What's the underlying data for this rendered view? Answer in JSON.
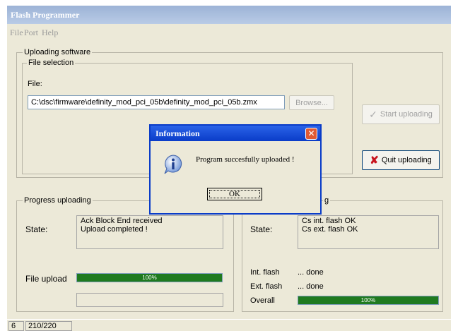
{
  "window": {
    "title": "Flash Programmer"
  },
  "menu": {
    "items": [
      "File",
      "Port",
      "Help"
    ]
  },
  "uploading": {
    "group_label": "Uploading software",
    "file_selection_label": "File selection",
    "file_label": "File:",
    "file_path": "C:\\dsc\\firmware\\definity_mod_pci_05b\\definity_mod_pci_05b.zmx",
    "browse_label": "Browse...",
    "start_label": "Start uploading",
    "quit_label": "Quit uploading"
  },
  "progress": {
    "group_label": "Progress uploading",
    "state_label": "State:",
    "state_lines": [
      "Ack Block End received",
      "Upload completed !"
    ],
    "file_upload_label": "File upload",
    "file_upload_percent": 100,
    "file_upload_text": "100%"
  },
  "flashing": {
    "group_label_visible": "g",
    "state_label": "State:",
    "state_lines": [
      "Cs int. flash OK",
      "Cs ext. flash OK"
    ],
    "int_flash_label": "Int. flash",
    "int_flash_value": "... done",
    "ext_flash_label": "Ext. flash",
    "ext_flash_value": "... done",
    "overall_label": "Overall",
    "overall_percent": 100,
    "overall_text": "100%"
  },
  "statusbar": {
    "cell1": "6",
    "cell2": "210/220"
  },
  "dialog": {
    "title": "Information",
    "message": "Program succesfully uploaded !",
    "ok_label": "OK",
    "close_glyph": "✕"
  },
  "colors": {
    "progress_fill": "#1f7a1f",
    "dialog_title": "#0a3cc8",
    "close_button": "#e05a34"
  }
}
